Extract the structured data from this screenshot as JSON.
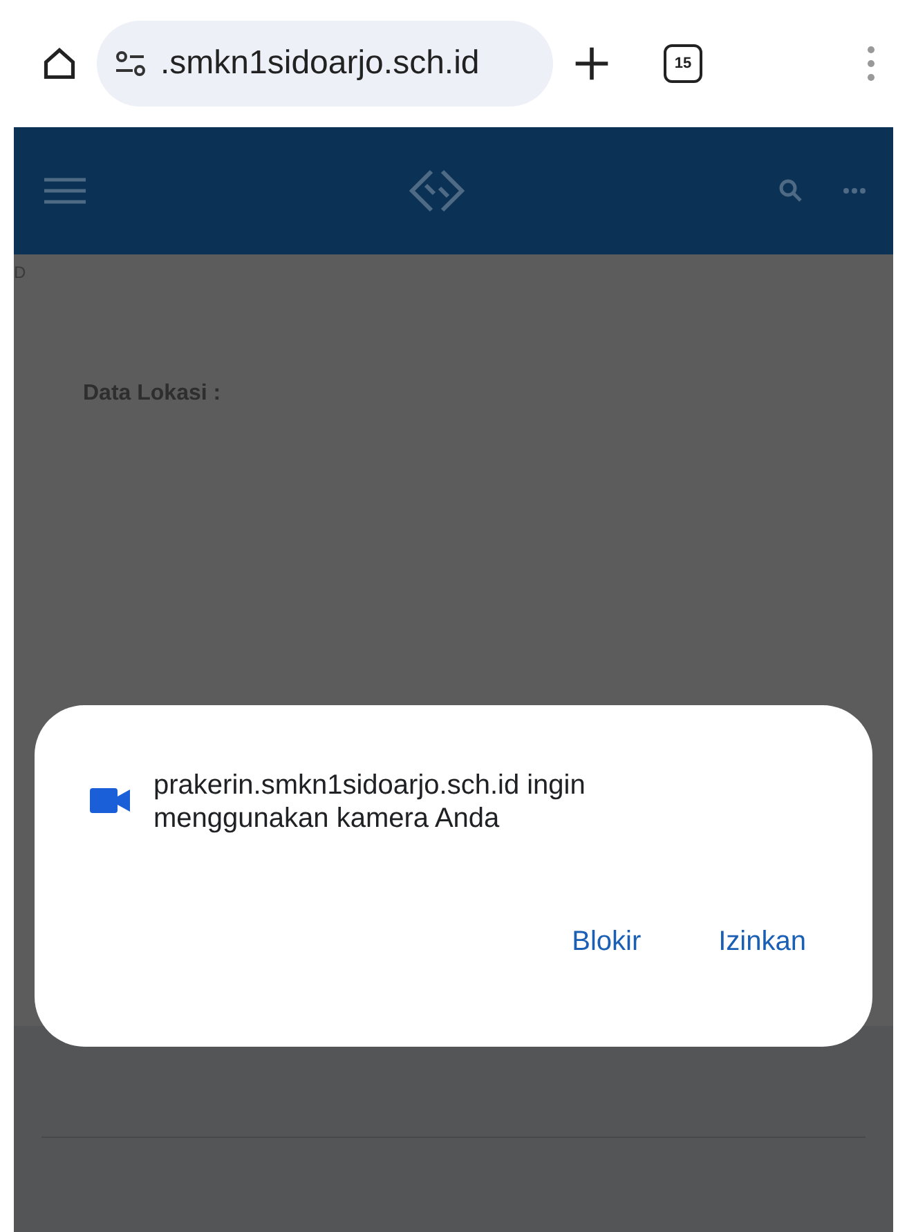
{
  "browser": {
    "url": ".smkn1sidoarjo.sch.id",
    "tab_count": "15"
  },
  "page": {
    "corner_text": "D",
    "section_label": "Data Lokasi :"
  },
  "dialog": {
    "message": "prakerin.smkn1sidoarjo.sch.id ingin menggunakan kamera Anda",
    "buttons": [
      {
        "label": "Blokir"
      },
      {
        "label": "Izinkan"
      }
    ]
  }
}
